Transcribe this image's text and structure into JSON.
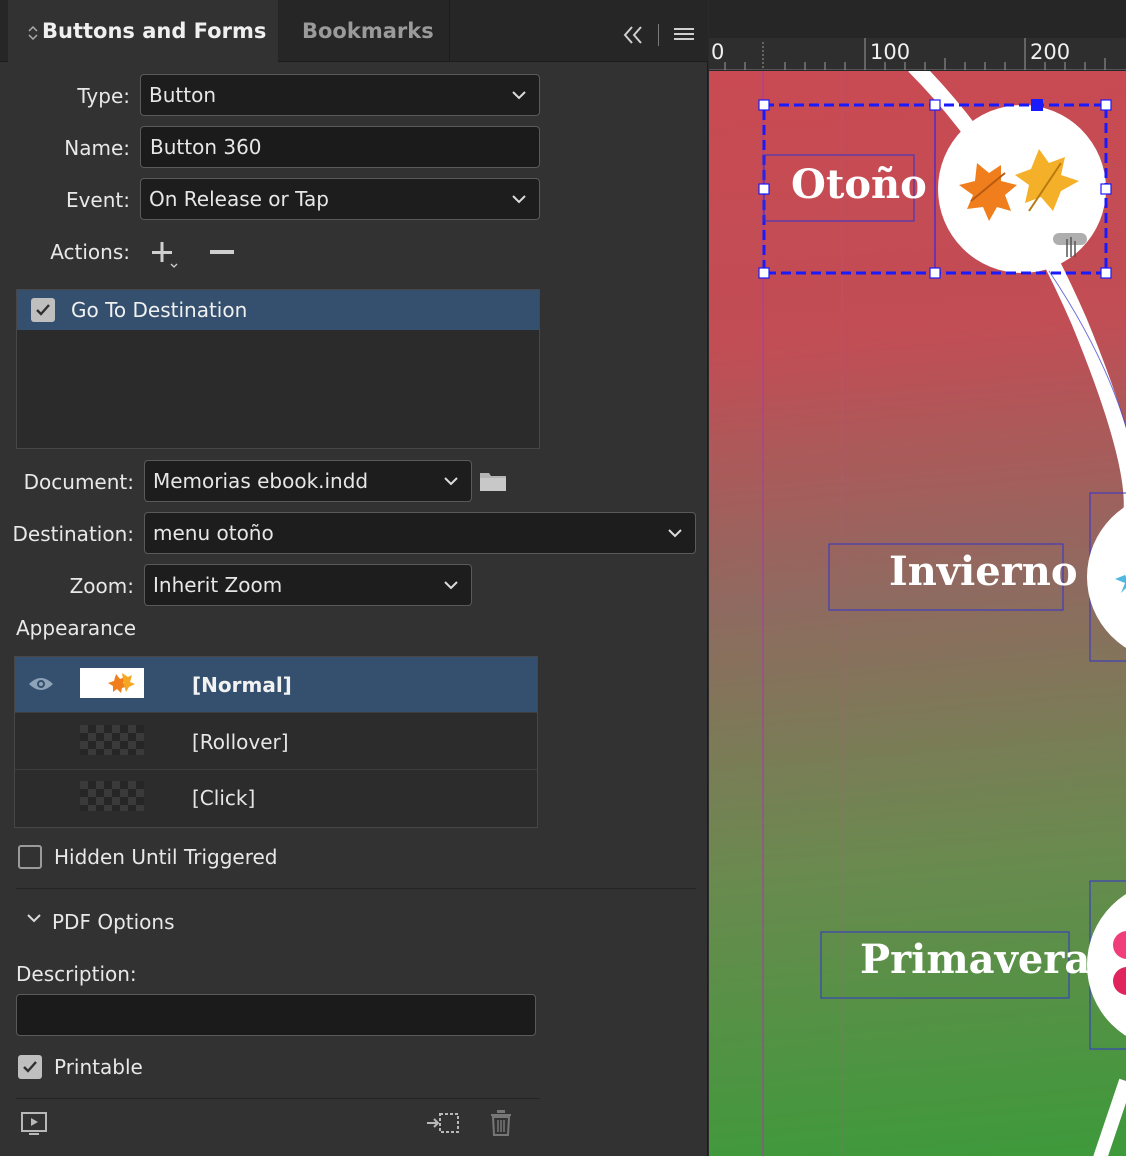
{
  "panel": {
    "tabs": [
      {
        "label": "Buttons and Forms"
      },
      {
        "label": "Bookmarks"
      }
    ],
    "type": {
      "label": "Type:",
      "value": "Button"
    },
    "name": {
      "label": "Name:",
      "value": "Button 360"
    },
    "event": {
      "label": "Event:",
      "value": "On Release or Tap"
    },
    "actions": {
      "label": "Actions:",
      "items": [
        {
          "label": "Go To Destination",
          "checked": true
        }
      ]
    },
    "document": {
      "label": "Document:",
      "value": "Memorias ebook.indd"
    },
    "destination": {
      "label": "Destination:",
      "value": "menu otoño"
    },
    "zoom": {
      "label": "Zoom:",
      "value": "Inherit Zoom"
    },
    "appearance": {
      "heading": "Appearance",
      "states": [
        {
          "label": "[Normal]",
          "selected": true
        },
        {
          "label": "[Rollover]",
          "selected": false
        },
        {
          "label": "[Click]",
          "selected": false
        }
      ]
    },
    "hidden_until_triggered": {
      "label": "Hidden Until Triggered",
      "checked": false
    },
    "pdf_options": {
      "heading": "PDF Options",
      "description_label": "Description:",
      "description_value": "",
      "printable": {
        "label": "Printable",
        "checked": true
      }
    }
  },
  "canvas": {
    "ruler": [
      "0",
      "100",
      "200"
    ],
    "labels": [
      "Otoño",
      "Invierno",
      "Primavera"
    ]
  },
  "colors": {
    "selection": "#1a1aff",
    "highlight": "#34506e",
    "panel_bg": "#323232"
  }
}
